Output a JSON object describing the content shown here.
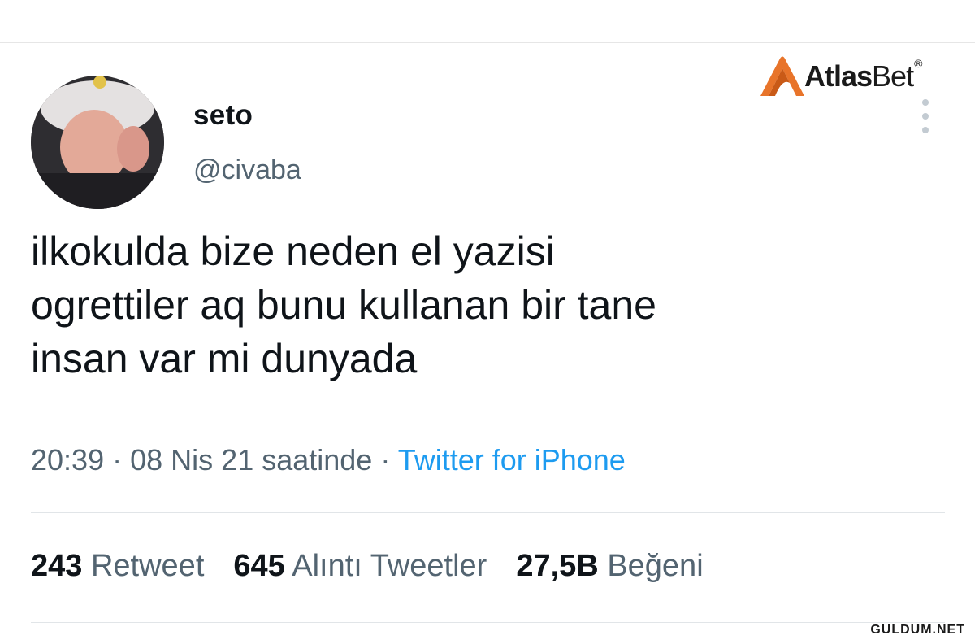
{
  "tweet": {
    "display_name": "seto",
    "handle": "@civaba",
    "text": "ilkokulda bize neden el yazisi\nogrettiler aq bunu kullanan bir tane\ninsan var mi dunyada",
    "time": "20:39",
    "date": "08 Nis 21 saatinde",
    "separator": "·",
    "source": "Twitter for iPhone"
  },
  "stats": {
    "retweets_count": "243",
    "retweets_label": "Retweet",
    "quotes_count": "645",
    "quotes_label": "Alıntı Tweetler",
    "likes_count": "27,5B",
    "likes_label": "Beğeni"
  },
  "brand": {
    "name_bold": "Atlas",
    "name_light": "Bet",
    "registered": "®"
  },
  "watermark": "GULDUM.NET",
  "colors": {
    "text": "#0f1419",
    "muted": "#536471",
    "link": "#1d9bf0",
    "brand_accent": "#e8742a"
  },
  "icons": {
    "more": "more-vertical-icon"
  }
}
